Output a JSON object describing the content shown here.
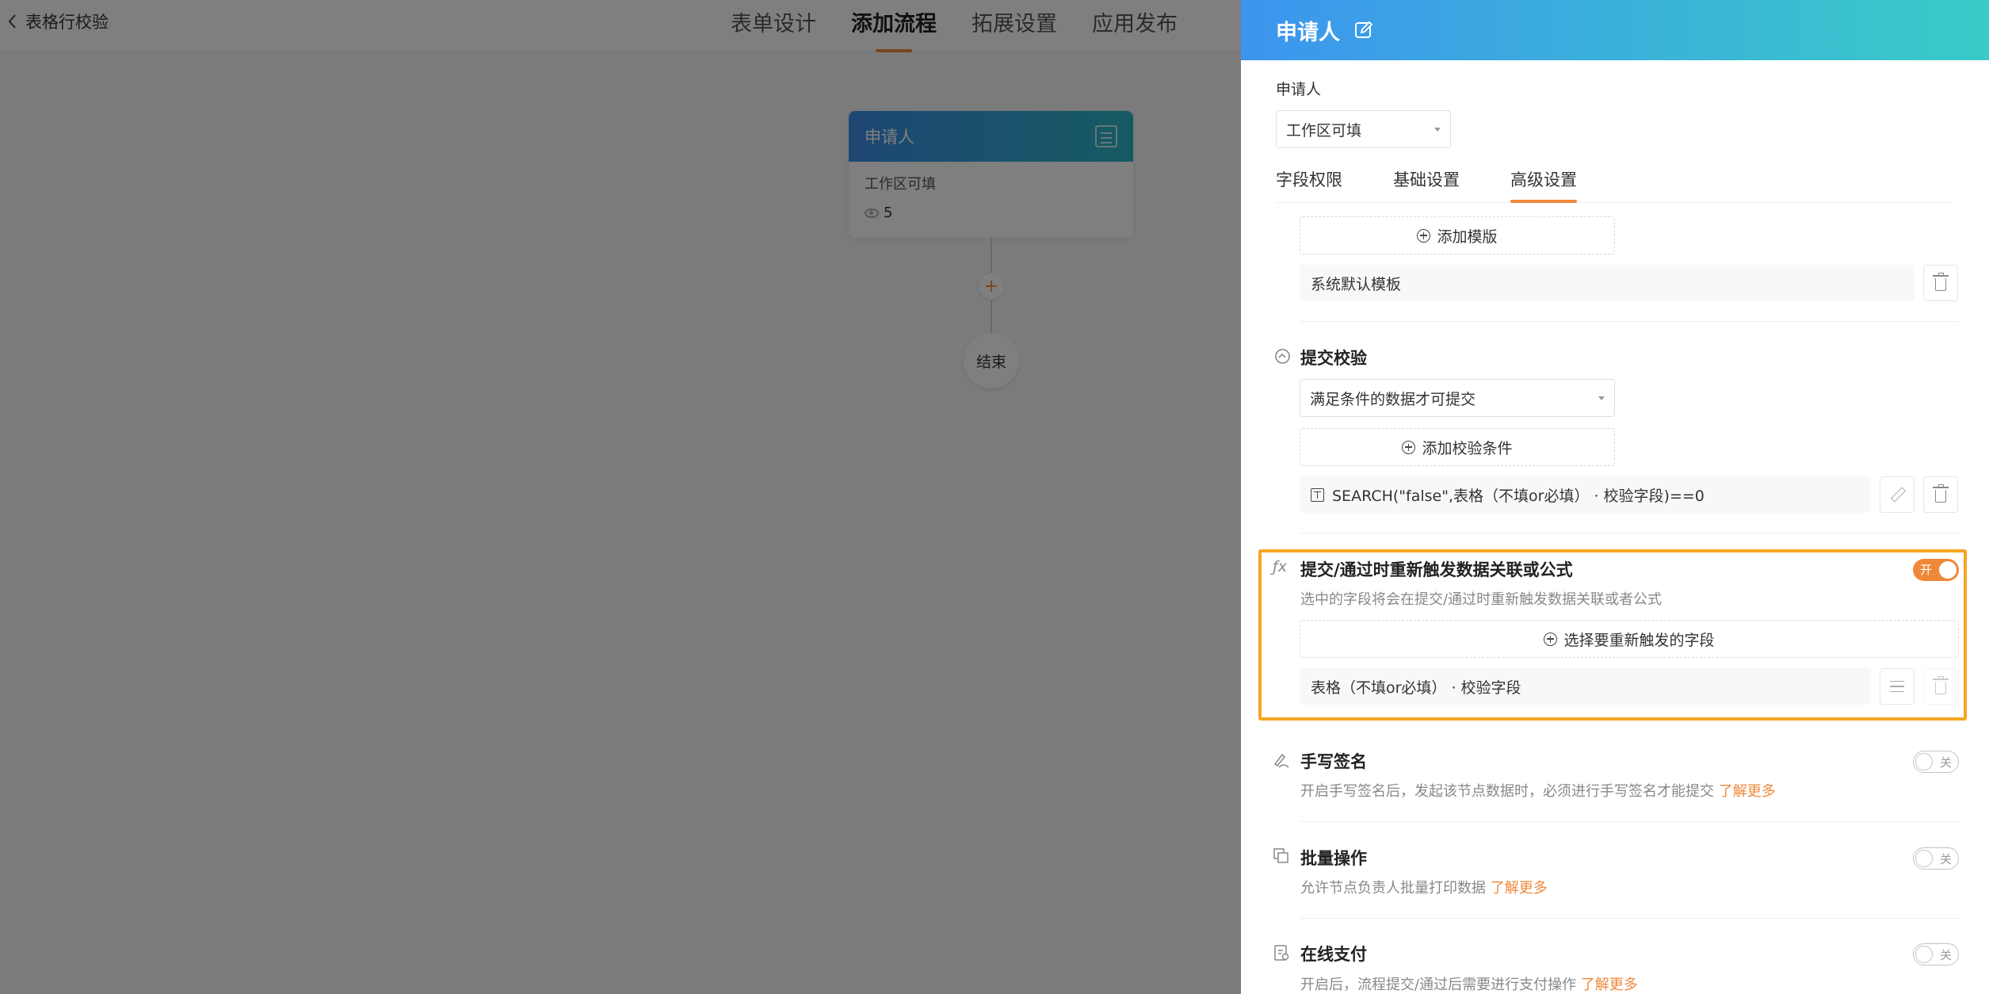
{
  "topbar": {
    "back_label": "表格行校验",
    "tabs": [
      {
        "label": "表单设计",
        "active": false
      },
      {
        "label": "添加流程",
        "active": true
      },
      {
        "label": "拓展设置",
        "active": false
      },
      {
        "label": "应用发布",
        "active": false
      }
    ]
  },
  "canvas": {
    "node": {
      "title": "申请人",
      "subtitle": "工作区可填",
      "count": "5"
    },
    "add_symbol": "+",
    "end_label": "结束"
  },
  "drawer": {
    "title": "申请人",
    "applicant_label": "申请人",
    "applicant_select": "工作区可填",
    "tabs": [
      {
        "label": "字段权限",
        "active": false
      },
      {
        "label": "基础设置",
        "active": false
      },
      {
        "label": "高级设置",
        "active": true
      }
    ],
    "template": {
      "add_button": "添加模版",
      "item": "系统默认模板"
    },
    "submit_check": {
      "title": "提交校验",
      "select_value": "满足条件的数据才可提交",
      "add_button": "添加校验条件",
      "condition": "SEARCH(\"false\",表格（不填or必填） · 校验字段)==0"
    },
    "retrigger": {
      "title": "提交/通过时重新触发数据关联或公式",
      "description": "选中的字段将会在提交/通过时重新触发数据关联或者公式",
      "toggle_text": "开",
      "toggle_on": true,
      "add_button": "选择要重新触发的字段",
      "field": "表格（不填or必填） · 校验字段"
    },
    "signature": {
      "title": "手写签名",
      "description": "开启手写签名后，发起该节点数据时，必须进行手写签名才能提交",
      "link": "了解更多",
      "toggle_text": "关",
      "toggle_on": false
    },
    "batch": {
      "title": "批量操作",
      "description": "允许节点负责人批量打印数据",
      "link": "了解更多",
      "toggle_text": "关",
      "toggle_on": false
    },
    "payment": {
      "title": "在线支付",
      "description": "开启后，流程提交/通过后需要进行支付操作",
      "link": "了解更多",
      "toggle_text": "关",
      "toggle_on": false
    }
  }
}
